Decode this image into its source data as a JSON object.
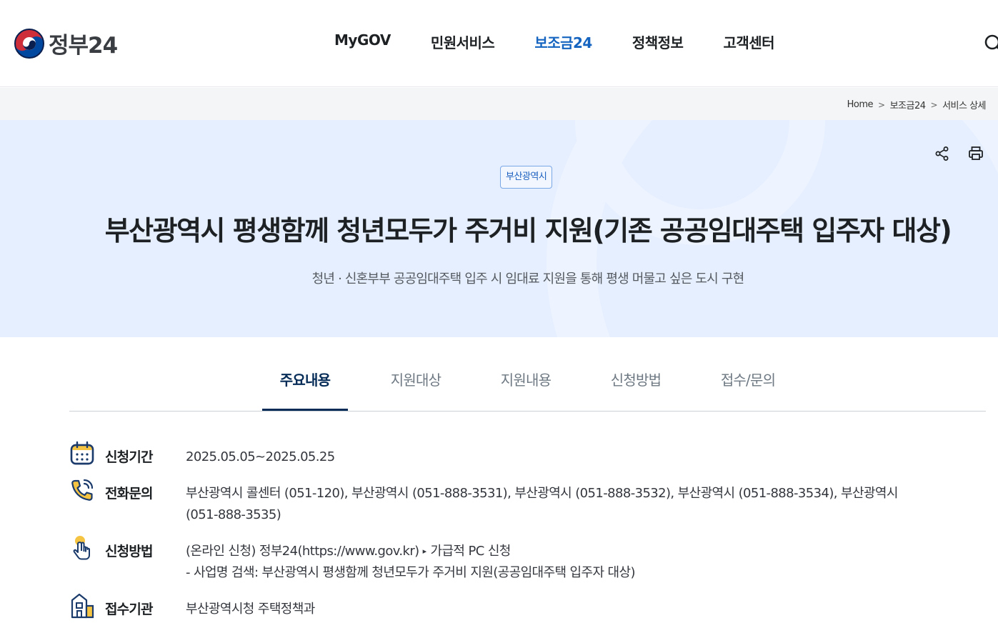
{
  "header": {
    "logo_text": "정부24",
    "nav": [
      {
        "label": "MyGOV"
      },
      {
        "label": "민원서비스"
      },
      {
        "label": "보조금24"
      },
      {
        "label": "정책정보"
      },
      {
        "label": "고객센터"
      }
    ]
  },
  "breadcrumb": [
    "Home",
    "보조금24",
    "서비스 상세"
  ],
  "hero": {
    "org_badge": "부산광역시",
    "title": "부산광역시 평생함께 청년모두가 주거비 지원(기존 공공임대주택 입주자 대상)",
    "subtitle": "청년 · 신혼부부 공공임대주택 입주 시 임대료 지원을 통해 평생 머물고 싶은 도시 구현"
  },
  "tabs": [
    {
      "label": "주요내용"
    },
    {
      "label": "지원대상"
    },
    {
      "label": "지원내용"
    },
    {
      "label": "신청방법"
    },
    {
      "label": "접수/문의"
    }
  ],
  "info": {
    "period": {
      "label": "신청기간",
      "value": "2025.05.05~2025.05.25"
    },
    "phone": {
      "label": "전화문의",
      "line1": "부산광역시 콜센터 (051-120), 부산광역시 (051-888-3531), 부산광역시 (051-888-3532), 부산광역시 (051-888-3534), 부산광역시",
      "line2": "(051-888-3535)"
    },
    "method": {
      "label": "신청방법",
      "line1_a": "(온라인 신청) 정부24(https://www.gov.kr)",
      "line1_arrow": "▸",
      "line1_b": "가급적 PC 신청",
      "line2": "- 사업명 검색: 부산광역시 평생함께 청년모두가 주거비 지원(공공임대주택 입주자 대상)"
    },
    "agency": {
      "label": "접수기관",
      "value": "부산광역시청 주택정책과"
    }
  },
  "colors": {
    "accent": "#1565c0",
    "hero_bg": "#e6efff",
    "tab_active": "#052b57"
  },
  "icons": [
    "taegeuk-logo-icon",
    "search-icon",
    "share-icon",
    "print-icon",
    "calendar-icon",
    "phone-icon",
    "tap-hand-icon",
    "building-icon"
  ]
}
